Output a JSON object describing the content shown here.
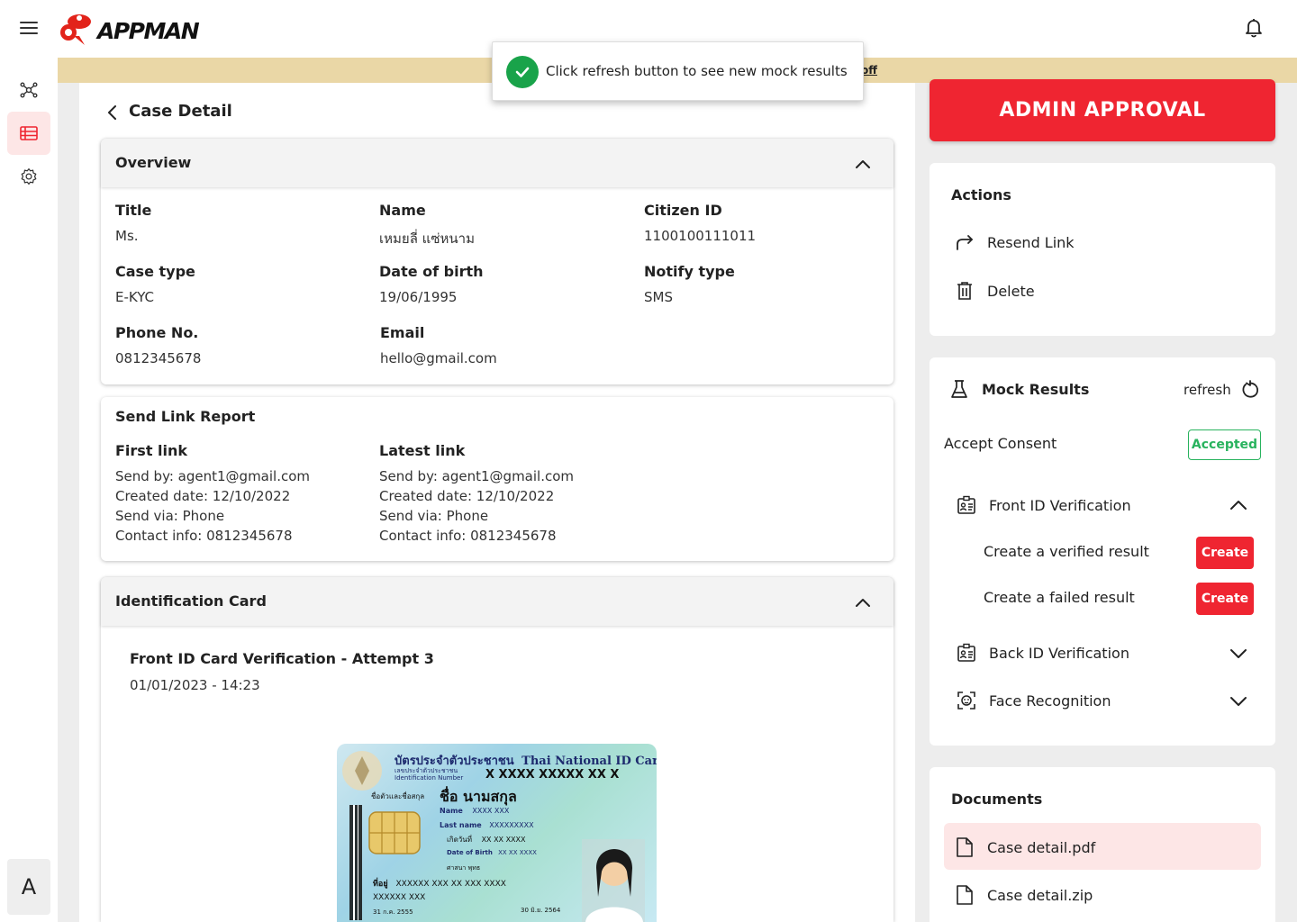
{
  "brand": {
    "name": "APPMAN"
  },
  "toast": {
    "message": "Click refresh button to see new mock results"
  },
  "banner": {
    "text": "off"
  },
  "rail": {
    "avatar_letter": "A"
  },
  "page": {
    "title": "Case Detail"
  },
  "overview": {
    "title": "Overview",
    "fields": [
      {
        "label": "Title",
        "value": "Ms."
      },
      {
        "label": "Name",
        "value": "เหมยลี่ แซ่หนาม"
      },
      {
        "label": "Citizen ID",
        "value": "1100100111011"
      },
      {
        "label": "Case type",
        "value": "E-KYC"
      },
      {
        "label": "Date of birth",
        "value": "19/06/1995"
      },
      {
        "label": "Notify type",
        "value": "SMS"
      },
      {
        "label": "Phone No.",
        "value": "0812345678"
      },
      {
        "label": "Email",
        "value": "hello@gmail.com"
      }
    ]
  },
  "send_link_report": {
    "title": "Send Link Report",
    "first": {
      "label": "First link",
      "lines": [
        "Send by: agent1@gmail.com",
        "Created date: 12/10/2022",
        "Send via: Phone",
        "Contact info: 0812345678"
      ]
    },
    "latest": {
      "label": "Latest link",
      "lines": [
        "Send by: agent1@gmail.com",
        "Created date: 12/10/2022",
        "Send via: Phone",
        "Contact info: 0812345678"
      ]
    }
  },
  "identification": {
    "title": "Identification Card",
    "attempt_title": "Front ID Card Verification - Attempt 3",
    "attempt_date": "01/01/2023 - 14:23",
    "card": {
      "header_th": "บัตรประจำตัวประชาชน",
      "header_en": "Thai National ID Card",
      "id_label": "เลขประจำตัวประชาชน",
      "id_label_en": "Identification Number",
      "id_number": "X XXXX XXXXX XX X",
      "name_label": "ชื่อตัวและชื่อสกุล",
      "name_th": "ชื่อ นามสกุล",
      "name_en_label": "Name",
      "name_en": "XXXX XXX",
      "last_name_label": "Last name",
      "last_name": "XXXXXXXXX",
      "dob_label_th": "เกิดวันที่",
      "dob_th": "XX XX XXXX",
      "dob_label": "Date of Birth",
      "dob": "XX XX XXXX",
      "religion": "ศาสนา พุทธ",
      "address_label": "ที่อยู่",
      "address": "XXXXXX XXX XX XXX XXXX",
      "address2": "XXXXXX XXX",
      "issue_date": "31 ก.ค. 2555",
      "expiry_date": "30 มิ.ย. 2564"
    }
  },
  "approval": {
    "label": "ADMIN APPROVAL"
  },
  "actions": {
    "title": "Actions",
    "items": [
      {
        "label": "Resend Link",
        "icon": "resend-icon"
      },
      {
        "label": "Delete",
        "icon": "trash-icon"
      }
    ]
  },
  "mock_results": {
    "title": "Mock Results",
    "refresh_label": "refresh",
    "consent_label": "Accept Consent",
    "consent_status": "Accepted",
    "front": {
      "label": "Front ID Verification",
      "options": [
        {
          "label": "Create a verified result",
          "button": "Create"
        },
        {
          "label": "Create a failed result",
          "button": "Create"
        }
      ]
    },
    "back": {
      "label": "Back ID Verification"
    },
    "face": {
      "label": "Face Recognition"
    }
  },
  "documents": {
    "title": "Documents",
    "items": [
      {
        "label": "Case detail.pdf",
        "icon": "file-icon"
      },
      {
        "label": "Case detail.zip",
        "icon": "file-icon"
      }
    ]
  },
  "colors": {
    "brand_red": "#ef2531",
    "accepted_green": "#29b35e",
    "toast_green": "#19a34a",
    "banner": "#ead7a6",
    "active_bg": "#fde6e6"
  }
}
